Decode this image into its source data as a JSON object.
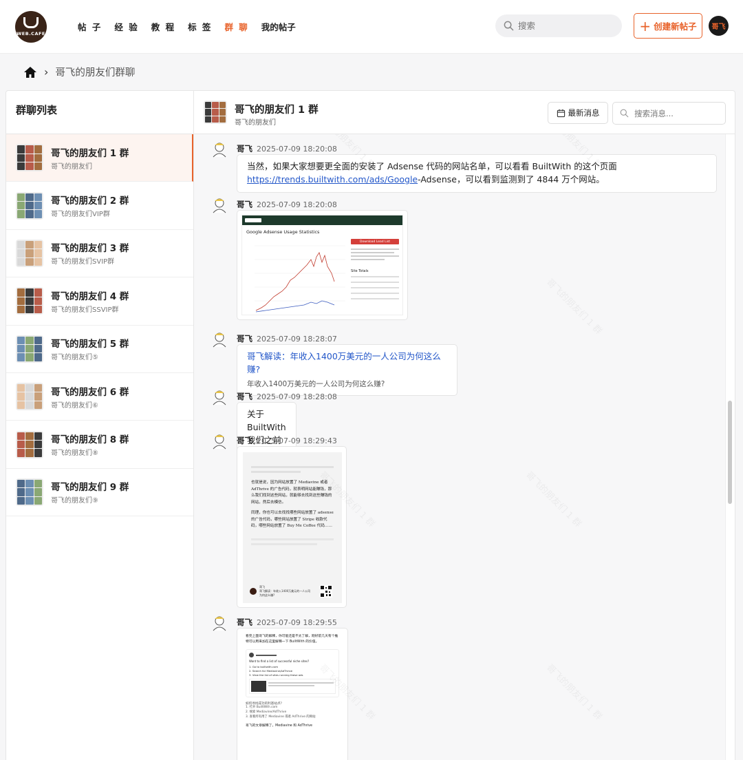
{
  "nav": {
    "logo_text": "WEB.CAFE",
    "links": [
      "帖 子",
      "经 验",
      "教 程",
      "标 签",
      "群 聊",
      "我的帖子"
    ],
    "search_placeholder": "搜索",
    "create_label": "创建新帖子",
    "user_avatar_text": "哥飞",
    "accent": "#e8622a"
  },
  "breadcrumb": {
    "current": "哥飞的朋友们群聊"
  },
  "sidebar": {
    "title": "群聊列表",
    "groups": [
      {
        "name": "哥飞的朋友们 1 群",
        "desc": "哥飞的朋友们"
      },
      {
        "name": "哥飞的朋友们 2 群",
        "desc": "哥飞的朋友们VIP群"
      },
      {
        "name": "哥飞的朋友们 3 群",
        "desc": "哥飞的朋友们SVIP群"
      },
      {
        "name": "哥飞的朋友们 4 群",
        "desc": "哥飞的朋友们SSVIP群"
      },
      {
        "name": "哥飞的朋友们 5 群",
        "desc": "哥飞的朋友们⑤"
      },
      {
        "name": "哥飞的朋友们 6 群",
        "desc": "哥飞的朋友们⑥"
      },
      {
        "name": "哥飞的朋友们 8 群",
        "desc": "哥飞的朋友们⑧"
      },
      {
        "name": "哥飞的朋友们 9 群",
        "desc": "哥飞的朋友们⑨"
      }
    ]
  },
  "chat": {
    "title": "哥飞的朋友们 1 群",
    "subtitle": "哥飞的朋友们",
    "latest_label": "最新消息",
    "search_placeholder": "搜索消息...",
    "watermark": "哥飞的朋友们 1 群",
    "messages": [
      {
        "sender": "哥飞",
        "time": "2025-07-09 18:20:08",
        "text_before": "当然，如果大家想要更全面的安装了 Adsense 代码的网站名单，可以看看 BuiltWith 的这个页面 ",
        "link": "https://trends.builtwith.com/ads/Google",
        "text_after": "-Adsense，可以看到监测到了 4844 万个网站。"
      },
      {
        "sender": "哥飞",
        "time": "2025-07-09 18:20:08",
        "image_title": "Google Adsense Usage Statistics",
        "image_button": "Download Lead List",
        "image_side_title": "Site Totals"
      },
      {
        "sender": "哥飞",
        "time": "2025-07-09 18:28:07",
        "link_title": "哥飞解读：年收入1400万美元的一人公司为何这么赚?",
        "link_sub": "年收入1400万美元的一人公司为何这么赚?"
      },
      {
        "sender": "哥飞",
        "time": "2025-07-09 18:28:08",
        "text": "关于 BuiltWith 我们之前写过一篇文章"
      },
      {
        "sender": "哥飞",
        "time": "2025-07-09 18:29:43",
        "article_p1": "也就是说，因为网站放置了 Mediavine 或者 AdThrive 的广告代码，就表明网站能赚钱，那么我们找到这些网站，就能够去找到这些赚钱的网站，然后去模仿。",
        "article_p2": "同理，你也可以去找找哪些网站放置了 adsense 的广告代码，哪些网站放置了 Stripe 收款代码，哪些网站放置了 Buy Me Coffee 代码……",
        "article_footer_name": "哥飞",
        "article_footer_text": "哥飞解读：年收入1400万美元的一人公司为何这么赚?"
      },
      {
        "sender": "哥飞",
        "time": "2025-07-09 18:29:55",
        "article_intro": "看完上面哥飞的解释，你可能还是不太了解，刚好前几天有个推特可以用来加在这里解释一下 BuiltWith 的价值。",
        "tweet_text": "Want to find a list of successful niche sites?",
        "tweet_steps": [
          "1. Go to builtwith.com",
          "2. Search for Mediavine/AdThrive",
          "3. View the list of sites running these ads"
        ],
        "article_q": "如何寻找成功的利基站点?",
        "article_steps": [
          "1. 打开 BuiltWith.com",
          "2. 搜索 Mediavine/AdThrive",
          "3. 查看所有用了 Mediavine 或者 AdThrive 的网站"
        ],
        "article_tail": "哥飞的文章解释了，Mediavine 和 AdThrive"
      }
    ]
  }
}
